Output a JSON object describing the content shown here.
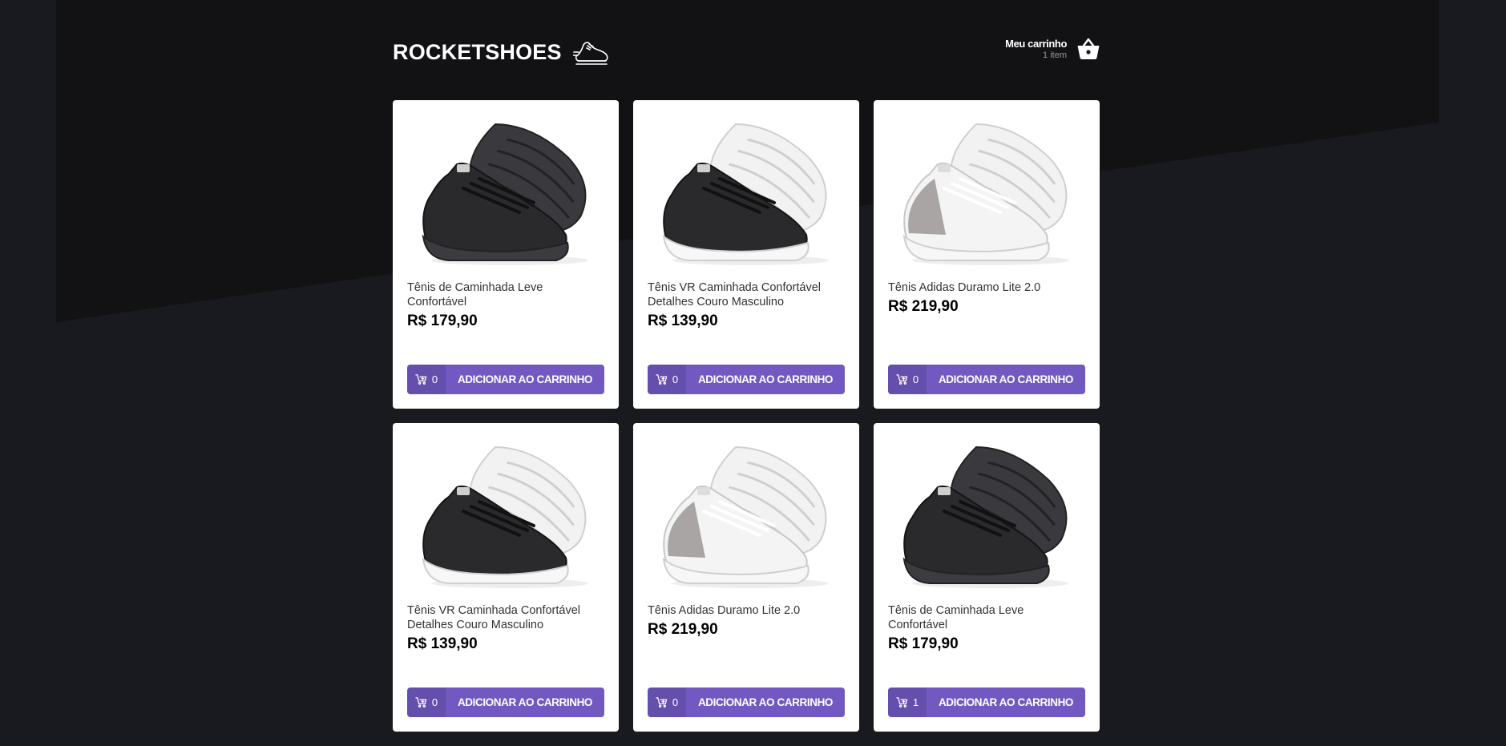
{
  "header": {
    "logo_text": "ROCKETSHOES",
    "logo_icon": "running-shoe-icon",
    "cart_title": "Meu carrinho",
    "cart_count": "1 item",
    "cart_icon": "shopping-basket-icon"
  },
  "colors": {
    "background": "#191920",
    "accent": "#7159c1",
    "card": "#ffffff"
  },
  "products": [
    {
      "title": "Tênis de Caminhada Leve Confortável",
      "price": "R$ 179,90",
      "qty": "0",
      "button_label": "ADICIONAR AO CARRINHO",
      "image": "black-sneaker"
    },
    {
      "title": "Tênis VR Caminhada Confortável Detalhes Couro Masculino",
      "price": "R$ 139,90",
      "qty": "0",
      "button_label": "ADICIONAR AO CARRINHO",
      "image": "black-white-sneaker"
    },
    {
      "title": "Tênis Adidas Duramo Lite 2.0",
      "price": "R$ 219,90",
      "qty": "0",
      "button_label": "ADICIONAR AO CARRINHO",
      "image": "white-sneaker"
    },
    {
      "title": "Tênis VR Caminhada Confortável Detalhes Couro Masculino",
      "price": "R$ 139,90",
      "qty": "0",
      "button_label": "ADICIONAR AO CARRINHO",
      "image": "black-white-sneaker"
    },
    {
      "title": "Tênis Adidas Duramo Lite 2.0",
      "price": "R$ 219,90",
      "qty": "0",
      "button_label": "ADICIONAR AO CARRINHO",
      "image": "white-sneaker"
    },
    {
      "title": "Tênis de Caminhada Leve Confortável",
      "price": "R$ 179,90",
      "qty": "1",
      "button_label": "ADICIONAR AO CARRINHO",
      "image": "black-sneaker"
    }
  ]
}
